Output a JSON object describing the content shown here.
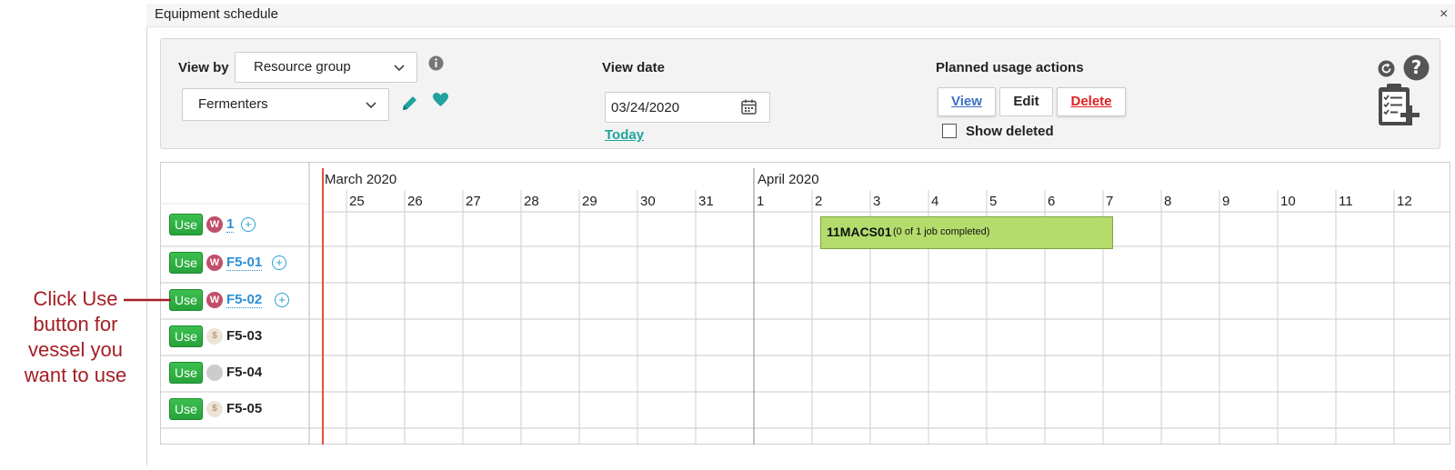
{
  "window": {
    "title": "Equipment schedule",
    "close_glyph": "×"
  },
  "toolbar": {
    "view_by_label": "View by",
    "view_by_value": "Resource group",
    "group_value": "Fermenters",
    "view_date_label": "View date",
    "view_date_value": "03/24/2020",
    "today_link": "Today",
    "planned_label": "Planned usage actions",
    "view_btn": "View",
    "edit_btn": "Edit",
    "delete_btn": "Delete",
    "show_deleted_label": "Show deleted"
  },
  "timeline": {
    "months": [
      "March 2020",
      "April 2020"
    ],
    "days": [
      "25",
      "26",
      "27",
      "28",
      "29",
      "30",
      "31",
      "1",
      "2",
      "3",
      "4",
      "5",
      "6",
      "7",
      "8",
      "9",
      "10",
      "11",
      "12"
    ]
  },
  "rows": [
    {
      "use_label": "Use",
      "badge": "W",
      "badge_color": "#c0506a",
      "name": "1",
      "is_link": true,
      "has_plus": true
    },
    {
      "use_label": "Use",
      "badge": "W",
      "badge_color": "#c0506a",
      "name": "F5-01",
      "is_link": true,
      "has_plus": true
    },
    {
      "use_label": "Use",
      "badge": "W",
      "badge_color": "#c0506a",
      "name": "F5-02",
      "is_link": true,
      "has_plus": true
    },
    {
      "use_label": "Use",
      "badge": "$",
      "badge_color": "#e8ddd0",
      "name": "F5-03",
      "is_link": false,
      "has_plus": false
    },
    {
      "use_label": "Use",
      "badge": "",
      "badge_color": "#cccccc",
      "name": "F5-04",
      "is_link": false,
      "has_plus": false
    },
    {
      "use_label": "Use",
      "badge": "$",
      "badge_color": "#e8ddd0",
      "name": "F5-05",
      "is_link": false,
      "has_plus": false
    }
  ],
  "event": {
    "code": "11MACS01",
    "detail": "(0 of 1 job completed)"
  },
  "annotation": {
    "text": "Click Use button for vessel you want to use"
  },
  "colors": {
    "accent_teal": "#20a39e",
    "use_green": "#2fae43",
    "event_green": "#b3dc6c",
    "today_line": "#e0523a",
    "annotation_red": "#a51d24"
  }
}
